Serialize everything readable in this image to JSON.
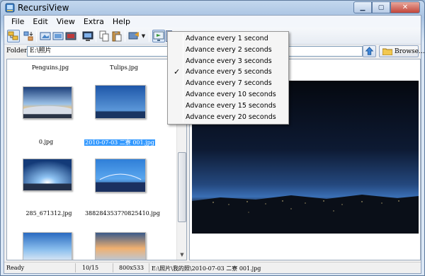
{
  "window": {
    "title": "RecursiView"
  },
  "menu": [
    "File",
    "Edit",
    "View",
    "Extra",
    "Help"
  ],
  "folder": {
    "label": "Folder:",
    "path": "E:\\照片",
    "browse_label": "Browse..."
  },
  "thumbnails": [
    {
      "label": "Penguins.jpg",
      "selected": false
    },
    {
      "label": "Tulips.jpg",
      "selected": false
    },
    {
      "label": "0.jpg",
      "selected": false
    },
    {
      "label": "2010-07-03 二寮 001.jpg",
      "selected": true
    },
    {
      "label": "285_671312.jpg",
      "selected": false
    },
    {
      "label": "3882843537?0825410.jpg",
      "selected": false
    }
  ],
  "slideshow_menu": {
    "items": [
      {
        "label": "Advance every 1 second",
        "checked": false
      },
      {
        "label": "Advance every 2 seconds",
        "checked": false
      },
      {
        "label": "Advance every 3 seconds",
        "checked": false
      },
      {
        "label": "Advance every 5 seconds",
        "checked": true
      },
      {
        "label": "Advance every 7 seconds",
        "checked": false
      },
      {
        "label": "Advance every 10 seconds",
        "checked": false
      },
      {
        "label": "Advance every 15 seconds",
        "checked": false
      },
      {
        "label": "Advance every 20 seconds",
        "checked": false
      }
    ],
    "check_glyph": "✓"
  },
  "status": {
    "state": "Ready",
    "position": "10/15",
    "dimensions": "800x533",
    "file_path": "E:\\照片\\我的照\\2010-07-03 二寮 001.jpg"
  },
  "icons": {
    "app": "recursiview-logo-icon",
    "up": "up-arrow-icon",
    "folder": "folder-icon"
  },
  "colors": {
    "selection": "#3399ff",
    "photo_sky_top": "#0b1020",
    "photo_horizon": "#3a6fb5"
  }
}
